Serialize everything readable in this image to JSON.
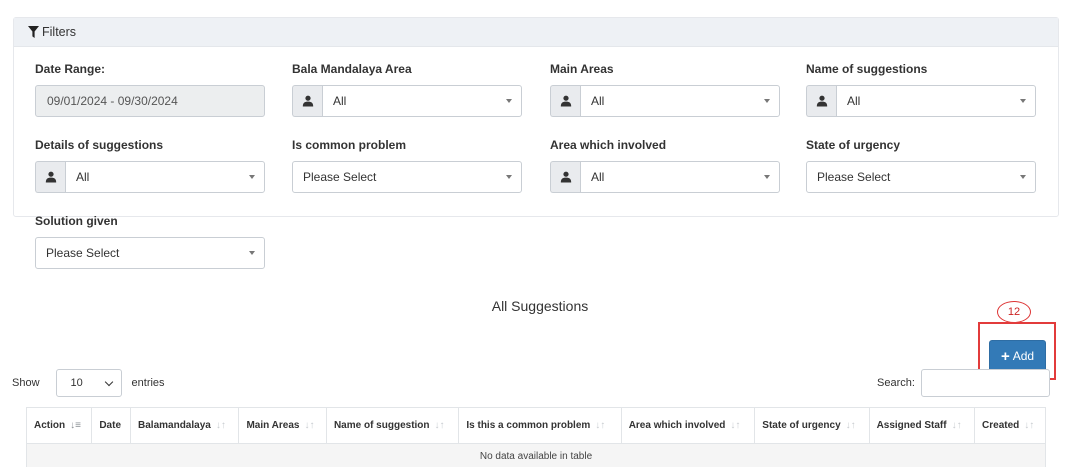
{
  "filters": {
    "title": "Filters",
    "date_range": {
      "label": "Date Range:",
      "value": "09/01/2024 - 09/30/2024"
    },
    "bala_mandalaya_area": {
      "label": "Bala Mandalaya Area",
      "value": "All"
    },
    "main_areas": {
      "label": "Main Areas",
      "value": "All"
    },
    "name_of_suggestions": {
      "label": "Name of suggestions",
      "value": "All"
    },
    "details_of_suggestions": {
      "label": "Details of suggestions",
      "value": "All"
    },
    "is_common_problem": {
      "label": "Is common problem",
      "value": "Please Select"
    },
    "area_which_involved": {
      "label": "Area which involved",
      "value": "All"
    },
    "state_of_urgency": {
      "label": "State of urgency",
      "value": "Please Select"
    },
    "solution_given": {
      "label": "Solution given",
      "value": "Please Select"
    }
  },
  "section_title": "All Suggestions",
  "annotation": {
    "label": "12",
    "color": "#e23b3b"
  },
  "add_button": {
    "label": "Add",
    "color": "#337ab7"
  },
  "table_controls": {
    "show_label": "Show",
    "page_length": "10",
    "entries_label": "entries",
    "search_label": "Search:",
    "search_value": ""
  },
  "table": {
    "columns": [
      "Action",
      "Date",
      "Balamandalaya",
      "Main Areas",
      "Name of suggestion",
      "Is this a common problem",
      "Area which involved",
      "State of urgency",
      "Assigned Staff",
      "Created"
    ],
    "empty_message": "No data available in table"
  },
  "icons": {
    "filter": "funnel-icon",
    "user": "user-icon",
    "dropdown": "caret-down-icon",
    "add": "plus-icon",
    "sort": "sort-icon"
  }
}
